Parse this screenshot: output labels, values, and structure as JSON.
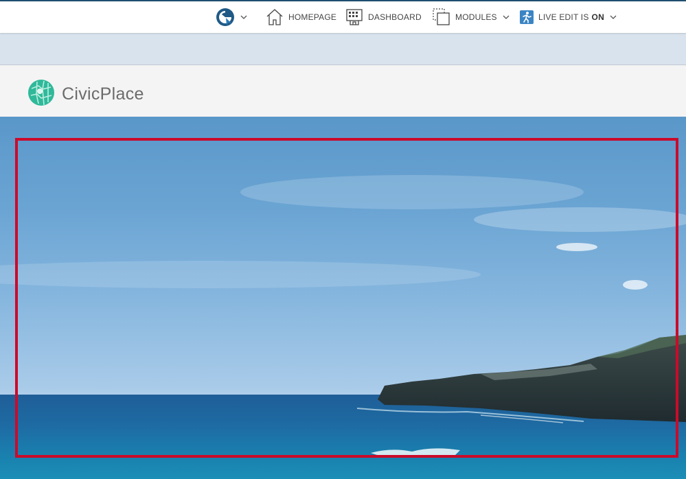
{
  "toolbar": {
    "logo_icon": "civicplus-logo-icon",
    "items": [
      {
        "label": "HOMEPAGE",
        "icon": "home-icon"
      },
      {
        "label": "DASHBOARD",
        "icon": "dashboard-icon"
      },
      {
        "label": "MODULES",
        "icon": "modules-icon"
      }
    ],
    "live_edit": {
      "label": "LIVE EDIT IS",
      "state": "ON",
      "icon": "live-edit-icon"
    }
  },
  "site": {
    "brand_name": "CivicPlace",
    "brand_icon": "globe-map-icon"
  },
  "hero": {
    "image": "coastal-cliff-ocean-photo",
    "selection_color": "#cc0a2a"
  },
  "colors": {
    "accent": "#1f4d6e",
    "subbar": "#d9e3ee",
    "header": "#f4f4f4",
    "brand_green": "#2fb99a"
  }
}
